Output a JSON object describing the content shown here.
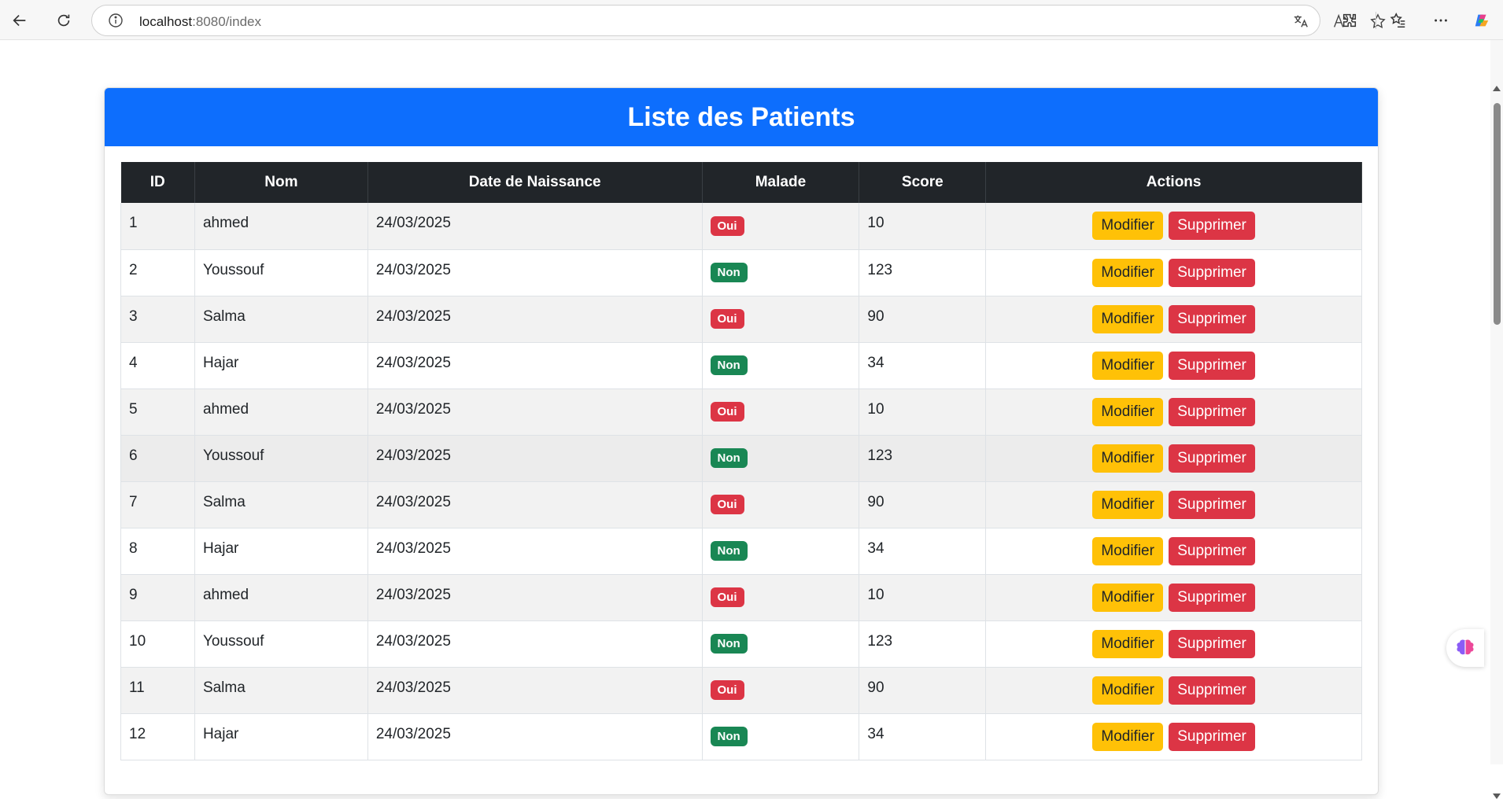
{
  "browser": {
    "url_host": "localhost",
    "url_rest": ":8080/index",
    "icons": [
      "back-icon",
      "reload-icon",
      "info-icon",
      "translate-icon",
      "read-aloud-icon",
      "favorite-icon",
      "extensions-icon",
      "favorites-list-icon",
      "more-icon",
      "copilot-icon"
    ]
  },
  "page": {
    "title": "Liste des Patients",
    "columns": [
      "ID",
      "Nom",
      "Date de Naissance",
      "Malade",
      "Score",
      "Actions"
    ],
    "edit_label": "Modifier",
    "delete_label": "Supprimer",
    "rows": [
      {
        "id": "1",
        "nom": "ahmed",
        "date": "24/03/2025",
        "malade": "Oui",
        "score": "10"
      },
      {
        "id": "2",
        "nom": "Youssouf",
        "date": "24/03/2025",
        "malade": "Non",
        "score": "123"
      },
      {
        "id": "3",
        "nom": "Salma",
        "date": "24/03/2025",
        "malade": "Oui",
        "score": "90"
      },
      {
        "id": "4",
        "nom": "Hajar",
        "date": "24/03/2025",
        "malade": "Non",
        "score": "34"
      },
      {
        "id": "5",
        "nom": "ahmed",
        "date": "24/03/2025",
        "malade": "Oui",
        "score": "10"
      },
      {
        "id": "6",
        "nom": "Youssouf",
        "date": "24/03/2025",
        "malade": "Non",
        "score": "123"
      },
      {
        "id": "7",
        "nom": "Salma",
        "date": "24/03/2025",
        "malade": "Oui",
        "score": "90"
      },
      {
        "id": "8",
        "nom": "Hajar",
        "date": "24/03/2025",
        "malade": "Non",
        "score": "34"
      },
      {
        "id": "9",
        "nom": "ahmed",
        "date": "24/03/2025",
        "malade": "Oui",
        "score": "10"
      },
      {
        "id": "10",
        "nom": "Youssouf",
        "date": "24/03/2025",
        "malade": "Non",
        "score": "123"
      },
      {
        "id": "11",
        "nom": "Salma",
        "date": "24/03/2025",
        "malade": "Oui",
        "score": "90"
      },
      {
        "id": "12",
        "nom": "Hajar",
        "date": "24/03/2025",
        "malade": "Non",
        "score": "34"
      }
    ]
  },
  "colors": {
    "header_blue": "#0d6efd",
    "table_head": "#212529",
    "badge_oui": "#dc3545",
    "badge_non": "#198754",
    "btn_modifier": "#ffc107",
    "btn_supprimer": "#dc3545"
  }
}
